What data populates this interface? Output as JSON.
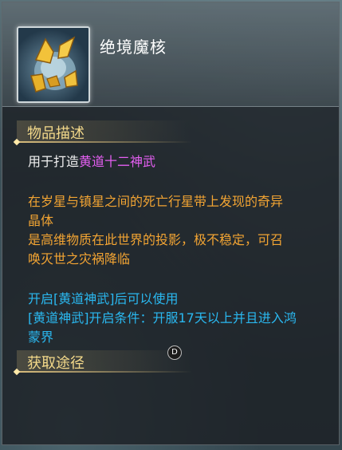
{
  "item": {
    "name": "绝境魔核",
    "icon": "demon-core-icon"
  },
  "sections": {
    "description_title": "物品描述",
    "acquire_title": "获取途径"
  },
  "description": {
    "use_prefix": "用于打造",
    "use_target": "黄道十二神武",
    "lore_line1": "在岁星与镇星之间的死亡行星带上发现的奇异",
    "lore_line2": "晶体",
    "lore_line3": "是高维物质在此世界的投影，极不稳定，可召",
    "lore_line4": "唤灭世之灾祸降临",
    "req_line1": "开启[黄道神武]后可以使用",
    "req_line2": "[黄道神武]开启条件：开服17天以上并且进入鸿",
    "req_line3": "蒙界"
  },
  "cursor_label": "D",
  "colors": {
    "title": "#ffffff",
    "section": "#f3d98a",
    "highlight": "#e45ff2",
    "lore": "#f2a433",
    "requirement": "#2ab8f0"
  }
}
